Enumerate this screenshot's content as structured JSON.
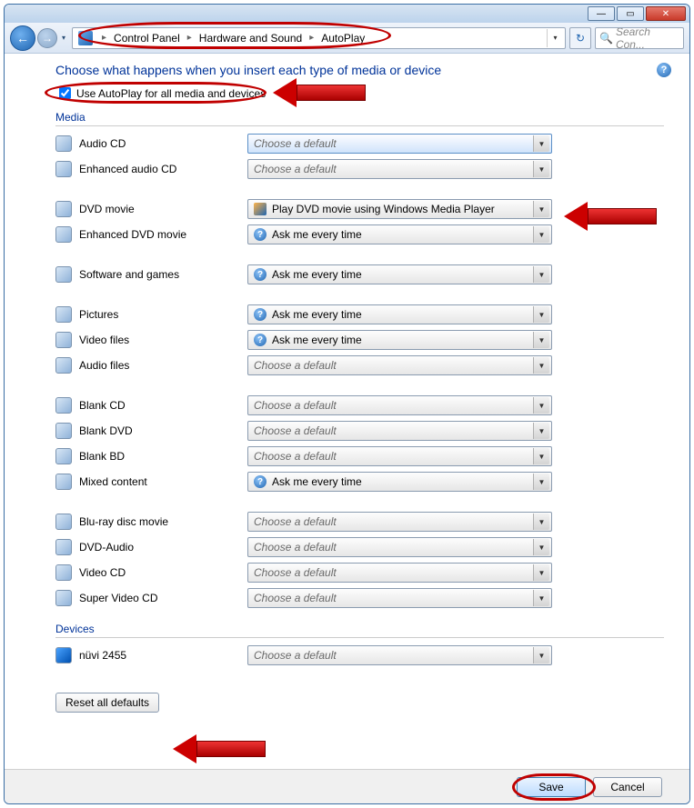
{
  "titlebar": {
    "minimize": "—",
    "maximize": "▭",
    "close": "✕"
  },
  "addrbar": {
    "back": "←",
    "forward": "→",
    "dropdown": "▾",
    "crumb1": "Control Panel",
    "crumb2": "Hardware and Sound",
    "crumb3": "AutoPlay",
    "sep": "▸",
    "refresh": "↻",
    "search_placeholder": "Search Con..."
  },
  "content": {
    "heading": "Choose what happens when you insert each type of media or device",
    "checkbox_label": "Use AutoPlay for all media and devices",
    "help": "?",
    "sections": {
      "media": "Media",
      "devices": "Devices"
    },
    "placeholder": "Choose a default",
    "ask": "Ask me every time",
    "dvd_default": "Play DVD movie using Windows Media Player",
    "items": {
      "audio_cd": "Audio CD",
      "enh_audio_cd": "Enhanced audio CD",
      "dvd_movie": "DVD movie",
      "enh_dvd_movie": "Enhanced DVD movie",
      "software_games": "Software and games",
      "pictures": "Pictures",
      "video_files": "Video files",
      "audio_files": "Audio files",
      "blank_cd": "Blank CD",
      "blank_dvd": "Blank DVD",
      "blank_bd": "Blank BD",
      "mixed_content": "Mixed content",
      "bluray": "Blu-ray disc movie",
      "dvd_audio": "DVD-Audio",
      "video_cd": "Video CD",
      "super_video_cd": "Super Video CD",
      "nuvi": "nüvi 2455"
    },
    "reset": "Reset all defaults"
  },
  "footer": {
    "save": "Save",
    "cancel": "Cancel"
  }
}
